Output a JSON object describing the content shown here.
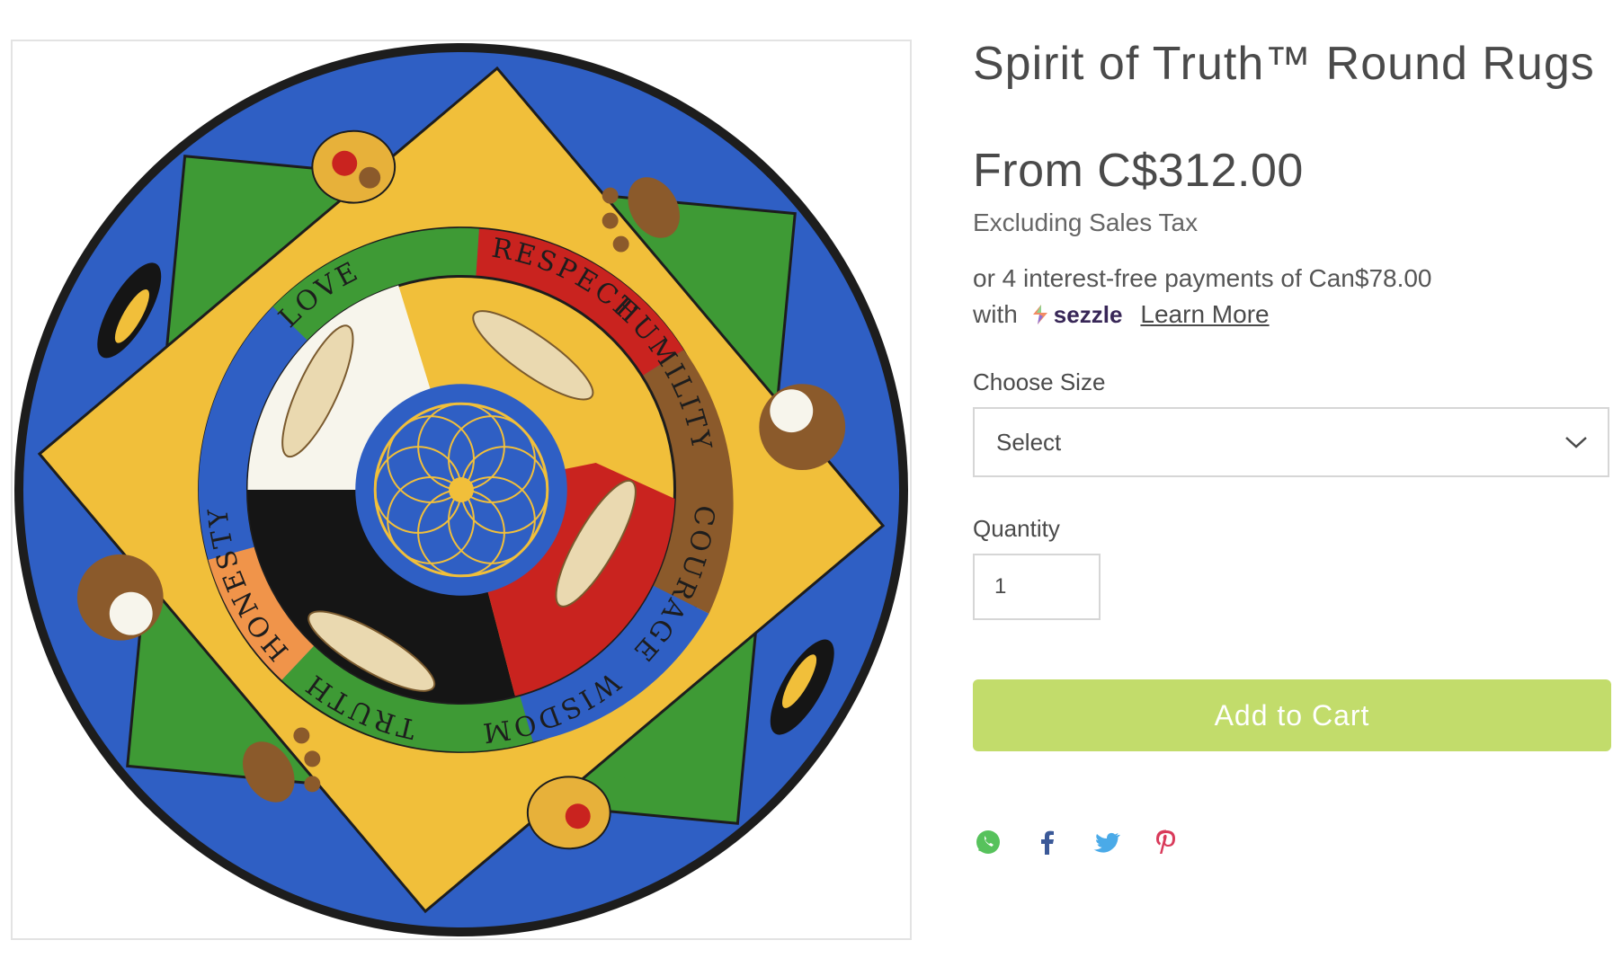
{
  "product": {
    "title": "Spirit of Truth™ Round Rugs",
    "price": "From C$312.00",
    "tax_note": "Excluding Sales Tax",
    "image_alt": "Spirit of Truth round rug"
  },
  "sezzle": {
    "line1": "or 4 interest-free payments of Can$78.00",
    "with": "with",
    "brand": "sezzle",
    "learn_more": "Learn More"
  },
  "rug_words": [
    "HUMILITY",
    "COURAGE",
    "WISDOM",
    "TRUTH",
    "HONESTY",
    "LOVE",
    "RESPECT"
  ],
  "size": {
    "label": "Choose Size",
    "selected": "Select"
  },
  "quantity": {
    "label": "Quantity",
    "value": "1"
  },
  "cart": {
    "button_label": "Add to Cart"
  },
  "share": {
    "icons": [
      "whatsapp-icon",
      "facebook-icon",
      "twitter-icon",
      "pinterest-icon"
    ]
  },
  "colors": {
    "button": "#c2dc6b",
    "text": "#4a4a4a",
    "rug_blue": "#2f5fc4",
    "rug_green": "#3e9a35",
    "rug_yellow": "#f1bf3a",
    "rug_red": "#c9231f"
  }
}
